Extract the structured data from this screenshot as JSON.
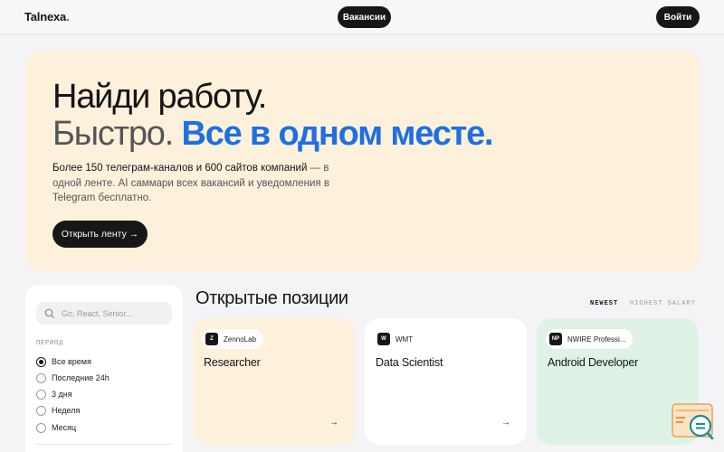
{
  "header": {
    "logo_text": "Talnexa",
    "logo_dot": ".",
    "nav_vacancies": "Вакансии",
    "login": "Войти"
  },
  "hero": {
    "line1": "Найди работу.",
    "line2_muted": "Быстро.",
    "line2_accent": "Все в одном месте.",
    "desc_strong": "Более 150 телеграм-каналов и 600 сайтов компаний",
    "desc_rest": "— в одной ленте. AI саммари всех вакансий и уведомления в Telegram бесплатно.",
    "cta": "Открыть ленту →"
  },
  "filters": {
    "search_placeholder": "Go, React, Senior...",
    "period_title": "ПЕРИОД",
    "period_options": [
      "Все время",
      "Последние 24h",
      "3 дня",
      "Неделя",
      "Месяц"
    ],
    "selected_period": "Все время"
  },
  "positions": {
    "title": "Открытые позиции",
    "sort_newest": "NEWEST",
    "sort_salary": "HIGHEST SALARY",
    "cards": [
      {
        "company_badge": "Z",
        "company": "ZennoLab",
        "title": "Researcher",
        "arrow": "→"
      },
      {
        "company_badge": "W",
        "company": "WMT",
        "title": "Data Scientist",
        "arrow": "→"
      },
      {
        "company_badge": "NP",
        "company": "NWIRE Professi...",
        "title": "Android Developer",
        "arrow": "→"
      }
    ]
  },
  "colors": {
    "accent": "#1f6fe0",
    "hero_bg": "#fdf1dc",
    "card_green": "#def3e6",
    "dark": "#171717"
  }
}
